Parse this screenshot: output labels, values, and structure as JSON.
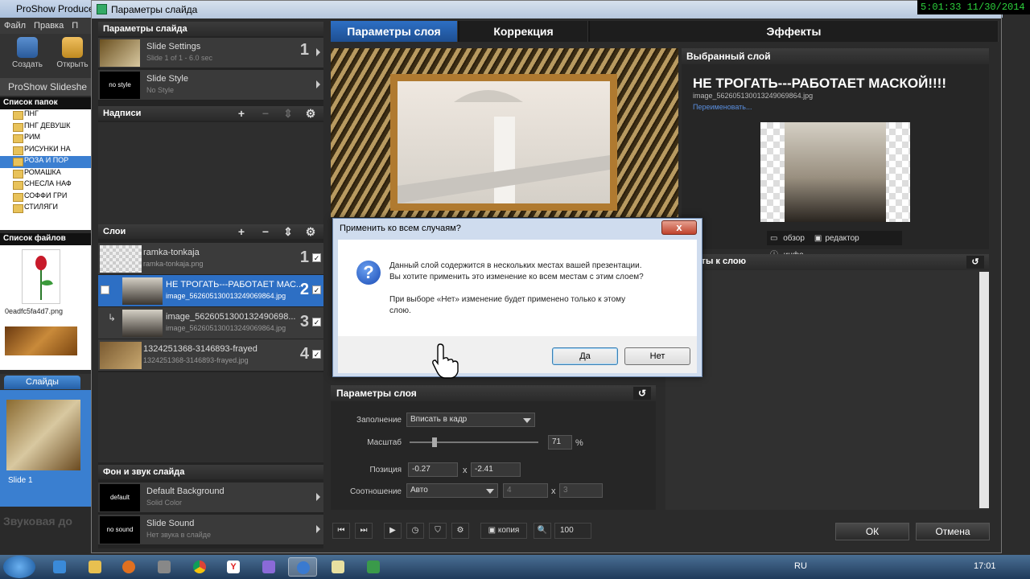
{
  "bg": {
    "title": "ProShow Producer",
    "menu": [
      "Файл",
      "Правка",
      "П"
    ],
    "toolbar": [
      "Создать",
      "Открыть"
    ],
    "show_title": "ProShow Slideshe",
    "folders_header": "Список папок",
    "folders": [
      "ПНГ",
      "ПНГ ДЕВУШК",
      "РИМ",
      "РИСУНКИ НА",
      "РОЗА И ПОР",
      "РОМАШКА",
      "СНЕСЛА НАФ",
      "СОФФИ ГРИ",
      "СТИЛЯГИ"
    ],
    "files_header": "Список файлов",
    "file_name": "0eadfc5fa4d7.png",
    "slides_tab": "Слайды",
    "slide_label": "Slide 1",
    "sound_label": "Звуковая до"
  },
  "win": {
    "title": "Параметры слайда",
    "slide_params_header": "Параметры слайда",
    "slide_settings": {
      "title": "Slide Settings",
      "sub": "Slide 1 of 1 - 6.0 sec",
      "num": "1"
    },
    "slide_style": {
      "thumb": "no style",
      "title": "Slide Style",
      "sub": "No Style"
    },
    "captions_header": "Надписи",
    "layers_header": "Слои",
    "layers": [
      {
        "title": "ramka-tonkaja",
        "sub": "ramka-tonkaja.png",
        "num": "1"
      },
      {
        "title": "НЕ  ТРОГАТЬ---РАБОТАЕТ МАС...",
        "sub": "image_56260513001324906986​4.jpg",
        "num": "2"
      },
      {
        "title": "image_5626051300132490698...",
        "sub": "image_562605130013249069864.jpg",
        "num": "3"
      },
      {
        "title": "1324251368-3146893-frayed",
        "sub": "1324251368-3146893-frayed.jpg",
        "num": "4"
      }
    ],
    "bg_sound_header": "Фон и звук слайда",
    "default_bg": {
      "thumb": "default",
      "title": "Default Background",
      "sub": "Solid Color"
    },
    "slide_sound": {
      "thumb": "no sound",
      "title": "Slide Sound",
      "sub": "Нет звука в слайде"
    },
    "tabs": [
      "Параметры слоя",
      "Коррекция",
      "Эффекты"
    ],
    "selected_header": "Выбранный слой",
    "selected_name": "НЕ  ТРОГАТЬ---РАБОТАЕТ МАСКОЙ!!!!",
    "selected_file": "image_562605130013249069864.jpg",
    "rename": "Переименовать...",
    "sel_btns": [
      "обзор",
      "редактор",
      "инфо"
    ],
    "effects_header": "Эффекты к слою",
    "layer_params_header": "Параметры слоя",
    "fields": {
      "fill_label": "Заполнение",
      "fill_value": "Вписать в кадр",
      "scale_label": "Масштаб",
      "scale_value": "71",
      "scale_unit": "%",
      "pos_label": "Позиция",
      "pos_x": "-0.27",
      "pos_y": "-2.41",
      "x_sep": "x",
      "ratio_label": "Соотношение",
      "ratio_value": "Авто",
      "ratio_w": "4",
      "ratio_h": "3"
    },
    "copy_btn": "копия",
    "zoom": "100",
    "ok": "ОК",
    "cancel": "Отмена"
  },
  "modal": {
    "title": "Применить ко всем случаям?",
    "line1": "Данный слой содержится в нескольких местах вашей презентации.",
    "line2": "Вы хотите применить это изменение ко всем местам с этим слоем?",
    "line3": "При выборе «Нет» изменение будет применено только к этому",
    "line4": "слою.",
    "yes": "Да",
    "no": "Нет",
    "close": "x"
  },
  "clock": "5:01:33  11/30/2014",
  "tray": {
    "lang": "RU",
    "time": "17:01"
  }
}
